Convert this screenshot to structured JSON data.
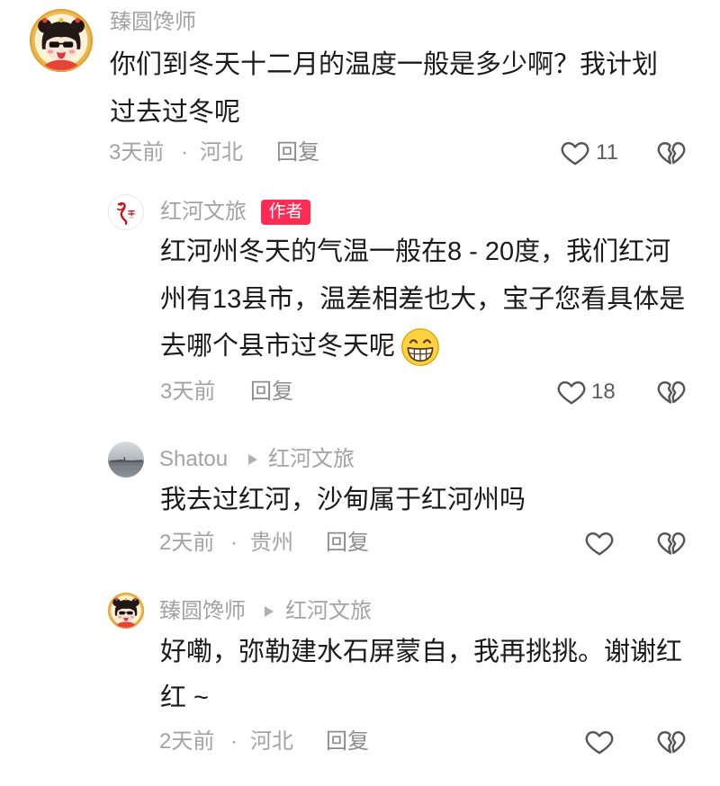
{
  "colors": {
    "text": "#1a1a1a",
    "secondary": "#a3a3a3",
    "reply_link": "#8c8c8c",
    "icon": "#555555",
    "count": "#5c5c5c",
    "author_badge_bg": "#fe2c55",
    "author_badge_text": "#ffffff",
    "arrow": "#b0b0b0"
  },
  "icons": {
    "like": "heart-outline-icon",
    "dislike": "broken-heart-icon",
    "reply_to_arrow": "triangle-right-icon"
  },
  "meta_separator": "·",
  "comment": {
    "avatar_icon": "cartoon-avatar-icon",
    "author": "臻圆馋师",
    "text_lines": [
      "你们到冬天十二月的温度一般是多少啊？我计划",
      "过去过冬呢"
    ],
    "time": "3天前",
    "location": "河北",
    "reply_label": "回复",
    "like_count": "11"
  },
  "replies": [
    {
      "avatar_icon": "honghe-logo-avatar-icon",
      "author": "红河文旅",
      "author_badge": "作者",
      "text_lines": [
        "红河州冬天的气温一般在8 - 20度，我们红河",
        "州有13县市，温差相差也大，宝子您看具体是",
        "去哪个县市过冬天呢"
      ],
      "trailing_emoji_icon": "grinning-face-emoji-icon",
      "time": "3天前",
      "reply_label": "回复",
      "like_count": "18"
    },
    {
      "avatar_icon": "landscape-photo-avatar-icon",
      "author": "Shatou",
      "reply_to": "红河文旅",
      "text_lines": [
        "我去过红河，沙甸属于红河州吗"
      ],
      "time": "2天前",
      "location": "贵州",
      "reply_label": "回复"
    },
    {
      "avatar_icon": "cartoon-avatar-icon",
      "author": "臻圆馋师",
      "reply_to": "红河文旅",
      "text_lines": [
        "好嘞，弥勒建水石屏蒙自，我再挑挑。谢谢红",
        "红 ~"
      ],
      "time": "2天前",
      "location": "河北",
      "reply_label": "回复"
    }
  ]
}
